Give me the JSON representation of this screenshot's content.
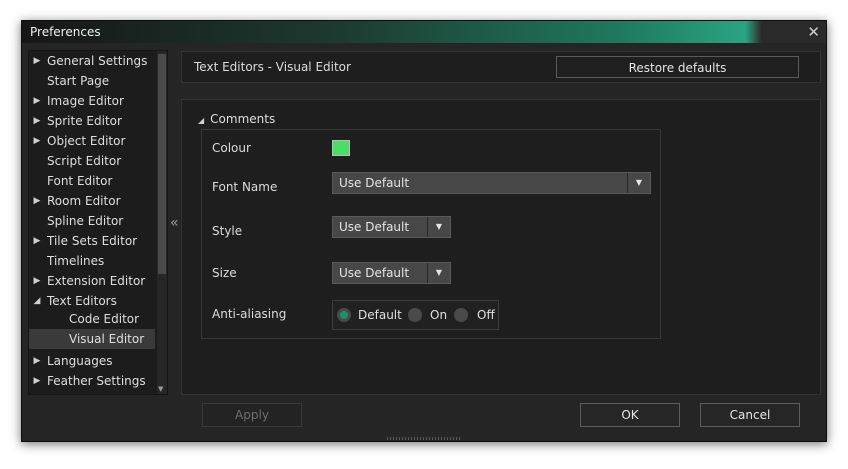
{
  "window": {
    "title": "Preferences",
    "close_glyph": "✕"
  },
  "tree": {
    "items": [
      {
        "label": "General Settings",
        "expandable": true
      },
      {
        "label": "Start Page",
        "expandable": false
      },
      {
        "label": "Image Editor",
        "expandable": true
      },
      {
        "label": "Sprite Editor",
        "expandable": true
      },
      {
        "label": "Object Editor",
        "expandable": true
      },
      {
        "label": "Script Editor",
        "expandable": false
      },
      {
        "label": "Font Editor",
        "expandable": false
      },
      {
        "label": "Room Editor",
        "expandable": true
      },
      {
        "label": "Spline Editor",
        "expandable": false
      },
      {
        "label": "Tile Sets Editor",
        "expandable": true
      },
      {
        "label": "Timelines",
        "expandable": false
      },
      {
        "label": "Extension Editor",
        "expandable": true
      },
      {
        "label": "Text Editors",
        "expandable": true,
        "expanded": true
      },
      {
        "label": "Code Editor",
        "child": true
      },
      {
        "label": "Visual Editor",
        "child": true,
        "selected": true
      },
      {
        "label": "Languages",
        "expandable": true
      },
      {
        "label": "Feather Settings",
        "expandable": true
      }
    ]
  },
  "collapse_glyph": "«",
  "header": {
    "title": "Text Editors - Visual Editor",
    "restore_label": "Restore defaults"
  },
  "section": {
    "title": "Comments",
    "colour_label": "Colour",
    "colour_value": "#4cdc6a",
    "font_name_label": "Font Name",
    "font_name_value": "Use Default",
    "style_label": "Style",
    "style_value": "Use Default",
    "size_label": "Size",
    "size_value": "Use Default",
    "aa_label": "Anti-aliasing",
    "aa_options": [
      "Default",
      "On",
      "Off"
    ],
    "aa_selected": "Default"
  },
  "footer": {
    "apply_label": "Apply",
    "ok_label": "OK",
    "cancel_label": "Cancel"
  },
  "colors": {
    "accent": "#1c8e6c",
    "title_gradient": "#2aa482"
  }
}
